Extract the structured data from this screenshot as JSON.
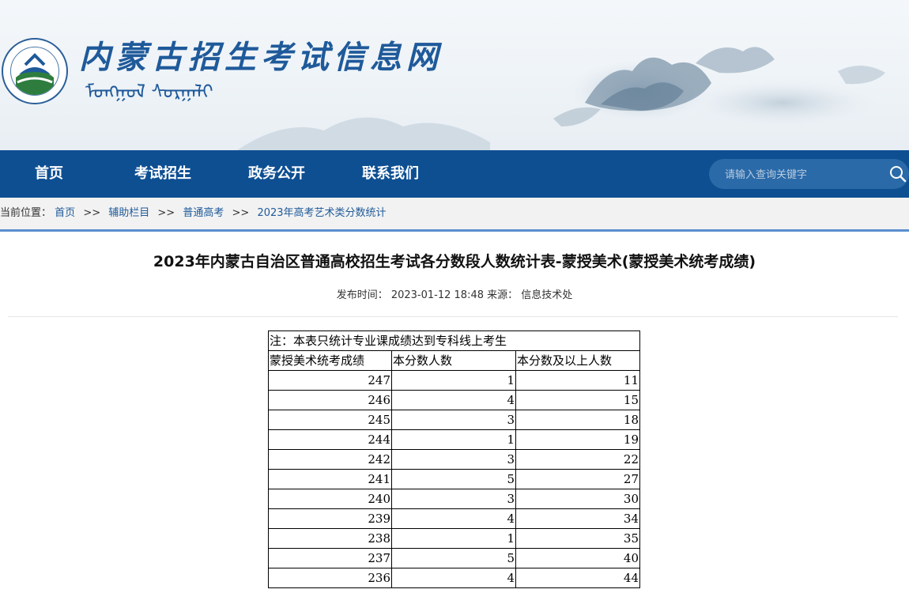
{
  "site": {
    "title": "内蒙古招生考试信息网",
    "subtitle_mongolian": "ᠮᠣᠩᠭᠣᠯ ᠰᠤᠷᠭᠠᠯᠢ"
  },
  "nav": {
    "items": [
      "首页",
      "考试招生",
      "政务公开",
      "联系我们"
    ],
    "search_placeholder": "请输入查询关键字"
  },
  "breadcrumb": {
    "prefix": "当前位置：",
    "items": [
      "首页",
      "辅助栏目",
      "普通高考",
      "2023年高考艺术类分数统计"
    ],
    "separator": ">>"
  },
  "article": {
    "title": "2023年内蒙古自治区普通高校招生考试各分数段人数统计表-蒙授美术(蒙授美术统考成绩)",
    "publish_label": "发布时间：",
    "publish_time": "2023-01-12 18:48",
    "source_label": "来源：",
    "source": "信息技术处"
  },
  "table": {
    "note": "注：本表只统计专业课成绩达到专科线上考生",
    "headers": [
      "蒙授美术统考成绩",
      "本分数人数",
      "本分数及以上人数"
    ],
    "rows": [
      [
        "247",
        "1",
        "11"
      ],
      [
        "246",
        "4",
        "15"
      ],
      [
        "245",
        "3",
        "18"
      ],
      [
        "244",
        "1",
        "19"
      ],
      [
        "242",
        "3",
        "22"
      ],
      [
        "241",
        "5",
        "27"
      ],
      [
        "240",
        "3",
        "30"
      ],
      [
        "239",
        "4",
        "34"
      ],
      [
        "238",
        "1",
        "35"
      ],
      [
        "237",
        "5",
        "40"
      ],
      [
        "236",
        "4",
        "44"
      ]
    ]
  },
  "colors": {
    "nav_bg": "#0e4f92",
    "accent": "#1f5a9a",
    "breadcrumb_border": "#5b8fd0"
  }
}
